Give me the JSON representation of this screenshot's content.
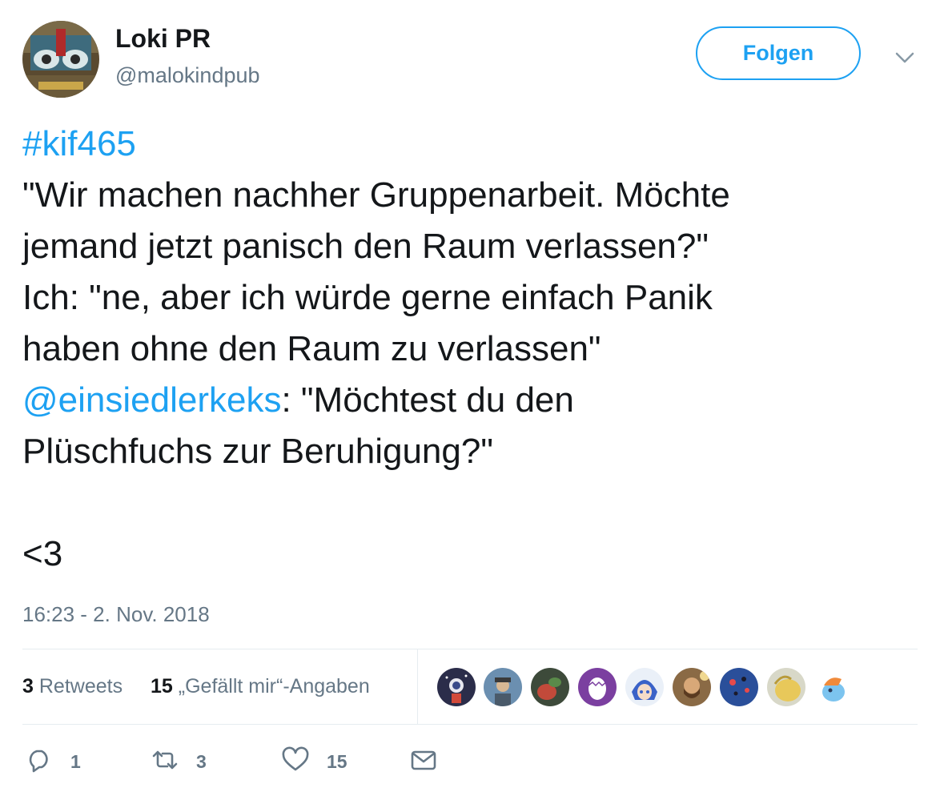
{
  "user": {
    "display_name": "Loki PR",
    "handle": "@malokindpub",
    "follow_label": "Folgen"
  },
  "tweet": {
    "hashtag": "#kif465",
    "lines": [
      "\"Wir machen nachher Gruppenarbeit. Möchte",
      "jemand jetzt panisch den Raum verlassen?\"",
      "Ich: \"ne, aber ich würde gerne einfach Panik",
      "haben ohne den Raum zu verlassen\""
    ],
    "mention": "@einsiedlerkeks",
    "mention_suffix": ": \"Möchtest du den",
    "last_line": "Plüschfuchs zur Beruhigung?\"",
    "closing": "<3",
    "timestamp": "16:23 - 2. Nov. 2018"
  },
  "stats": {
    "retweets_count": "3",
    "retweets_label": "Retweets",
    "likes_count": "15",
    "likes_label": "„Gefällt mir“-Angaben"
  },
  "likers": [
    {
      "icon": "avatar-astronaut",
      "color": "#2b2d4a"
    },
    {
      "icon": "avatar-person-hat",
      "color": "#6b8fb0"
    },
    {
      "icon": "avatar-plant",
      "color": "#3d4a3a"
    },
    {
      "icon": "avatar-egg",
      "color": "#7b3fa0"
    },
    {
      "icon": "avatar-anime-blue",
      "color": "#3a62c8"
    },
    {
      "icon": "avatar-bearded-man",
      "color": "#8a6a45"
    },
    {
      "icon": "avatar-balloons",
      "color": "#2a4f9a"
    },
    {
      "icon": "avatar-yellow-blob",
      "color": "#e8d89a"
    },
    {
      "icon": "avatar-pony",
      "color": "#7cc4ef"
    }
  ],
  "actions": {
    "reply_count": "1",
    "retweet_count": "3",
    "like_count": "15"
  },
  "colors": {
    "link": "#1da1f2",
    "text": "#14171a",
    "muted": "#657786",
    "divider": "#e6ecf0"
  }
}
